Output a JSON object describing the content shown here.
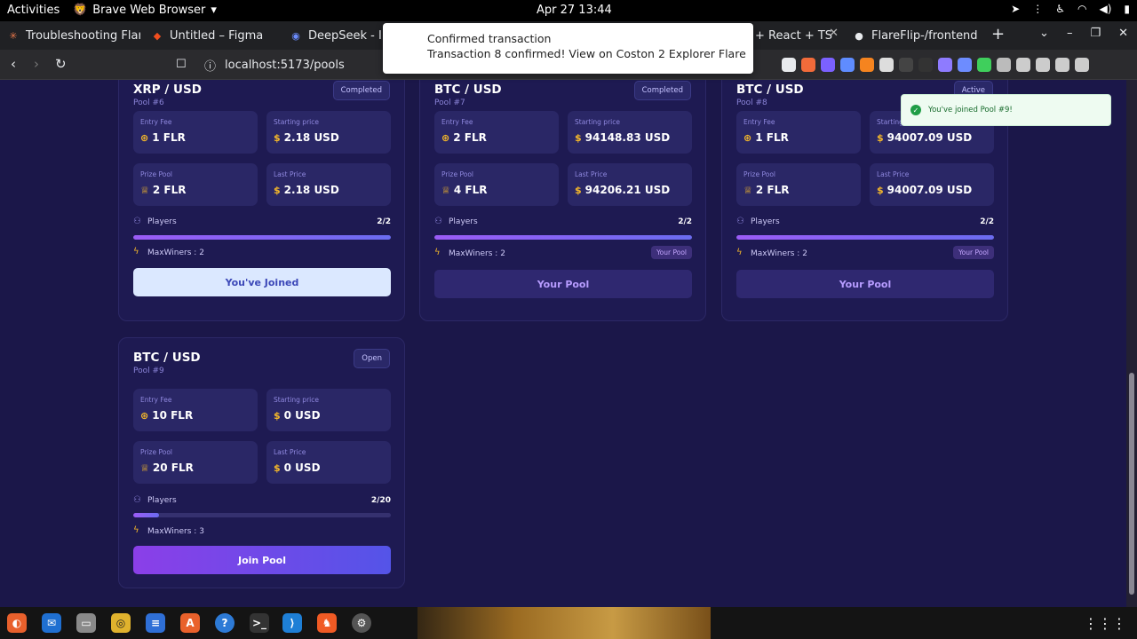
{
  "os": {
    "activities": "Activities",
    "app_name": "Brave Web Browser",
    "clock": "Apr 27  13:44"
  },
  "tabs": [
    {
      "label": "Troubleshooting Flar",
      "icon": "claude-icon"
    },
    {
      "label": "Untitled – Figma",
      "icon": "figma-icon"
    },
    {
      "label": "DeepSeek - Int",
      "icon": "deepseek-icon"
    },
    {
      "label": "+ React + TS",
      "icon": "vite-icon"
    },
    {
      "label": "FlareFlip-/frontend/",
      "icon": "github-icon"
    }
  ],
  "toolbar": {
    "url": "localhost:5173/pools"
  },
  "notification": {
    "title": "Confirmed transaction",
    "body": "Transaction 8 confirmed! View on Coston 2 Explorer Flare"
  },
  "toast": {
    "message": "You've joined Pool #9!"
  },
  "labels": {
    "entry_fee": "Entry Fee",
    "starting_price": "Starting price",
    "prize_pool": "Prize Pool",
    "last_price": "Last Price",
    "players": "Players"
  },
  "pools": [
    {
      "pair": "XRP / USD",
      "id": "Pool #6",
      "status": "Completed",
      "entry_fee": "1 FLR",
      "starting_price": "2.18 USD",
      "prize_pool": "2 FLR",
      "last_price": "2.18 USD",
      "players": "2/2",
      "players_fraction": 1.0,
      "max_winners": "MaxWiners : 2",
      "your_pool_badge": "",
      "button": "You've Joined"
    },
    {
      "pair": "BTC / USD",
      "id": "Pool #7",
      "status": "Completed",
      "entry_fee": "2 FLR",
      "starting_price": "94148.83 USD",
      "prize_pool": "4 FLR",
      "last_price": "94206.21 USD",
      "players": "2/2",
      "players_fraction": 1.0,
      "max_winners": "MaxWiners : 2",
      "your_pool_badge": "Your Pool",
      "button": "Your Pool"
    },
    {
      "pair": "BTC / USD",
      "id": "Pool #8",
      "status": "Active",
      "entry_fee": "1 FLR",
      "starting_price": "94007.09 USD",
      "prize_pool": "2 FLR",
      "last_price": "94007.09 USD",
      "players": "2/2",
      "players_fraction": 1.0,
      "max_winners": "MaxWiners : 2",
      "your_pool_badge": "Your Pool",
      "button": "Your Pool"
    },
    {
      "pair": "BTC / USD",
      "id": "Pool #9",
      "status": "Open",
      "entry_fee": "10 FLR",
      "starting_price": "0 USD",
      "prize_pool": "20 FLR",
      "last_price": "0 USD",
      "players": "2/20",
      "players_fraction": 0.1,
      "max_winners": "MaxWiners : 3",
      "your_pool_badge": "",
      "button": "Join Pool"
    }
  ]
}
